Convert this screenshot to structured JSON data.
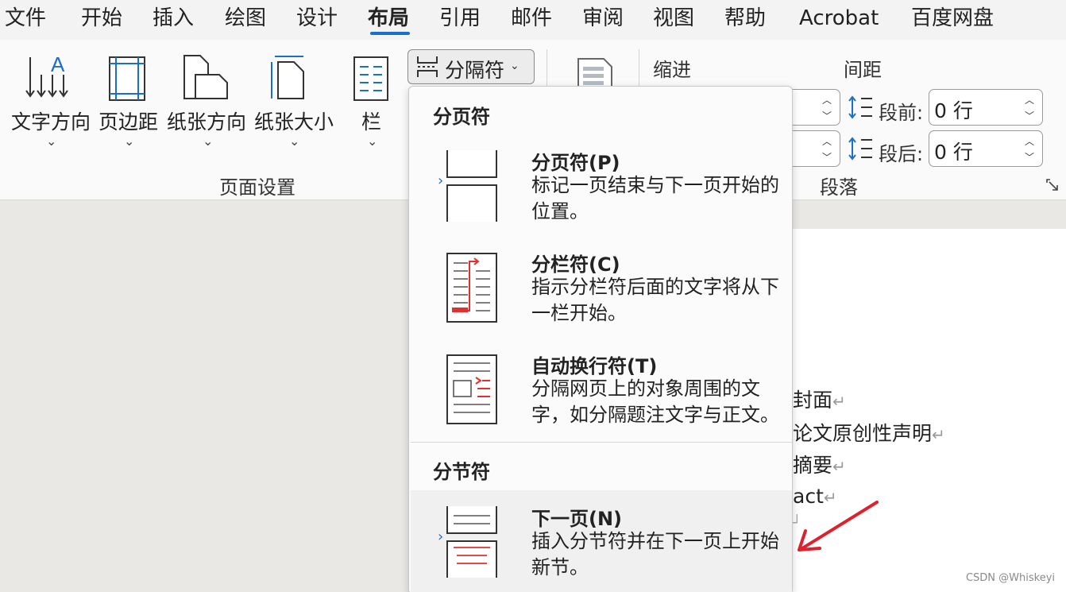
{
  "tabs": [
    "文件",
    "开始",
    "插入",
    "绘图",
    "设计",
    "布局",
    "引用",
    "邮件",
    "审阅",
    "视图",
    "帮助",
    "Acrobat",
    "百度网盘"
  ],
  "active_tab": "布局",
  "ribbon": {
    "text_direction": "文字方向",
    "margins": "页边距",
    "orientation": "纸张方向",
    "size": "纸张大小",
    "columns": "栏",
    "breaks": "分隔符",
    "page_setup_group": "页面设置",
    "indent_header": "缩进",
    "spacing_header": "间距",
    "spacing_before_label": "段前:",
    "spacing_before_value": "0 行",
    "spacing_after_label": "段后:",
    "spacing_after_value": "0 行",
    "paragraph_group": "段落"
  },
  "dropdown": {
    "page_breaks_header": "分页符",
    "section_breaks_header": "分节符",
    "items": [
      {
        "title": "分页符(P)",
        "desc": "标记一页结束与下一页开始的位置。"
      },
      {
        "title": "分栏符(C)",
        "desc": "指示分栏符后面的文字将从下一栏开始。"
      },
      {
        "title": "自动换行符(T)",
        "desc": "分隔网页上的对象周围的文字，如分隔题注文字与正文。"
      },
      {
        "title": "下一页(N)",
        "desc": "插入分节符并在下一页上开始新节。"
      }
    ]
  },
  "document": {
    "lines": [
      "封面",
      "论文原创性声明",
      "摘要",
      "act"
    ]
  },
  "watermark": "CSDN @Whiskeyi",
  "colors": {
    "accent": "#1a6fc7",
    "annotation_arrow": "#e0202c",
    "break_red": "#e03030"
  }
}
